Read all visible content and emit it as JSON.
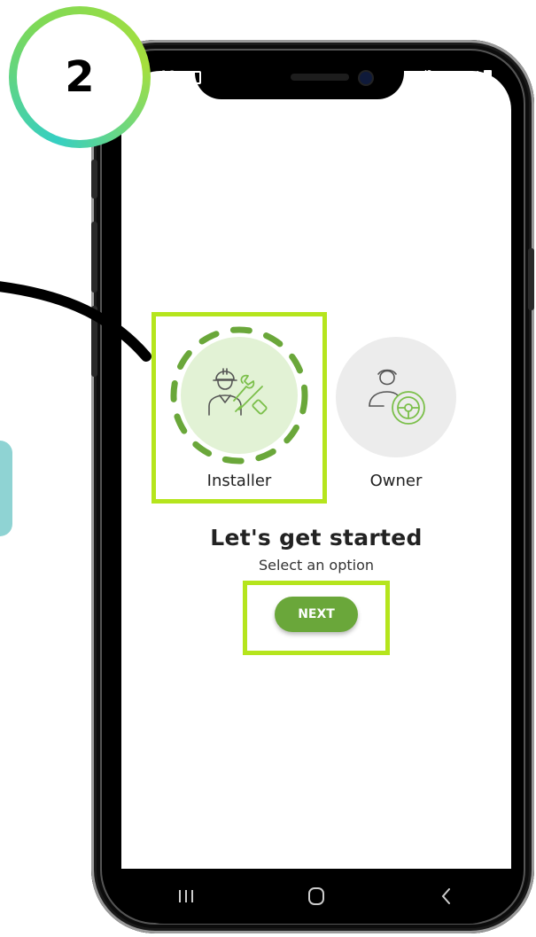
{
  "step_badge": {
    "number": "2"
  },
  "status_bar": {
    "time": ":16",
    "network": "4G",
    "network_sub": "LTE",
    "battery": "77%"
  },
  "options": [
    {
      "label": "Installer",
      "icon": "installer-worker-icon",
      "selected": true
    },
    {
      "label": "Owner",
      "icon": "owner-driver-icon",
      "selected": false
    }
  ],
  "heading": "Let's get started",
  "subheading": "Select an option",
  "next_button": {
    "label": "NEXT"
  },
  "navbar": {
    "items": [
      "recent-apps-icon",
      "home-icon",
      "back-icon"
    ]
  },
  "colors": {
    "accent": "#6aa73a",
    "highlight": "#b5e51d",
    "badge_gradient_start": "#35cfc2",
    "badge_gradient_end": "#a6df3d",
    "side_tab": "#8fd3d3"
  }
}
